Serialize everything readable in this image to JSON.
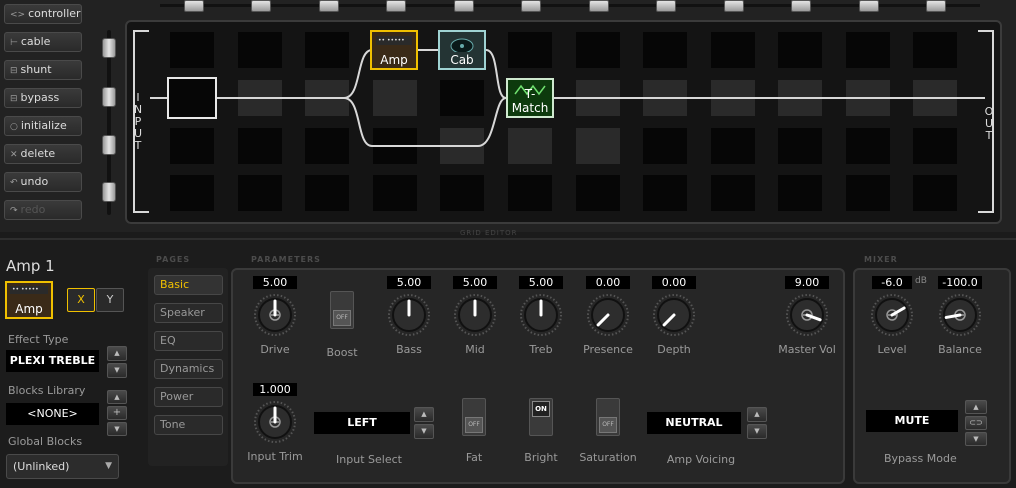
{
  "toolbar": {
    "controllers": "controllers",
    "cable": "cable",
    "shunt": "shunt",
    "bypass": "bypass",
    "initialize": "initialize",
    "delete": "delete",
    "undo": "undo",
    "redo": "redo"
  },
  "grid": {
    "input_label": "INPUT",
    "output_label": "OUT",
    "title": "GRID EDITOR",
    "blocks": {
      "amp": "Amp",
      "cab": "Cab",
      "tmatch": "T-Match"
    }
  },
  "block_panel": {
    "title": "Amp 1",
    "icon_label": "Amp",
    "x_button": "X",
    "y_button": "Y",
    "effect_type_label": "Effect Type",
    "effect_type_value": "PLEXI TREBLE",
    "library_label": "Blocks Library",
    "library_value": "<NONE>",
    "global_label": "Global Blocks",
    "global_value": "(Unlinked)"
  },
  "pages": {
    "header": "PAGES",
    "items": [
      "Basic",
      "Speaker",
      "EQ",
      "Dynamics",
      "Power",
      "Tone"
    ]
  },
  "parameters": {
    "header": "PARAMETERS",
    "knobs": [
      {
        "label": "Drive",
        "value": "5.00"
      },
      {
        "label": "Bass",
        "value": "5.00"
      },
      {
        "label": "Mid",
        "value": "5.00"
      },
      {
        "label": "Treb",
        "value": "5.00"
      },
      {
        "label": "Presence",
        "value": "0.00"
      },
      {
        "label": "Depth",
        "value": "0.00"
      },
      {
        "label": "Master Vol",
        "value": "9.00"
      },
      {
        "label": "Input Trim",
        "value": "1.000"
      }
    ],
    "boost_label": "Boost",
    "boost_state": "OFF",
    "input_select_label": "Input Select",
    "input_select_value": "LEFT",
    "fat_label": "Fat",
    "fat_state": "OFF",
    "bright_label": "Bright",
    "bright_state": "ON",
    "saturation_label": "Saturation",
    "saturation_state": "OFF",
    "amp_voicing_label": "Amp Voicing",
    "amp_voicing_value": "NEUTRAL"
  },
  "mixer": {
    "header": "MIXER",
    "level_label": "Level",
    "level_value": "-6.0",
    "level_unit": "dB",
    "balance_label": "Balance",
    "balance_value": "-100.0",
    "bypass_mode_label": "Bypass Mode",
    "bypass_mode_value": "MUTE"
  },
  "colors": {
    "accent": "#f0c000",
    "block_border": "#9fd3d3",
    "tmatch_border": "#7ed07e"
  }
}
